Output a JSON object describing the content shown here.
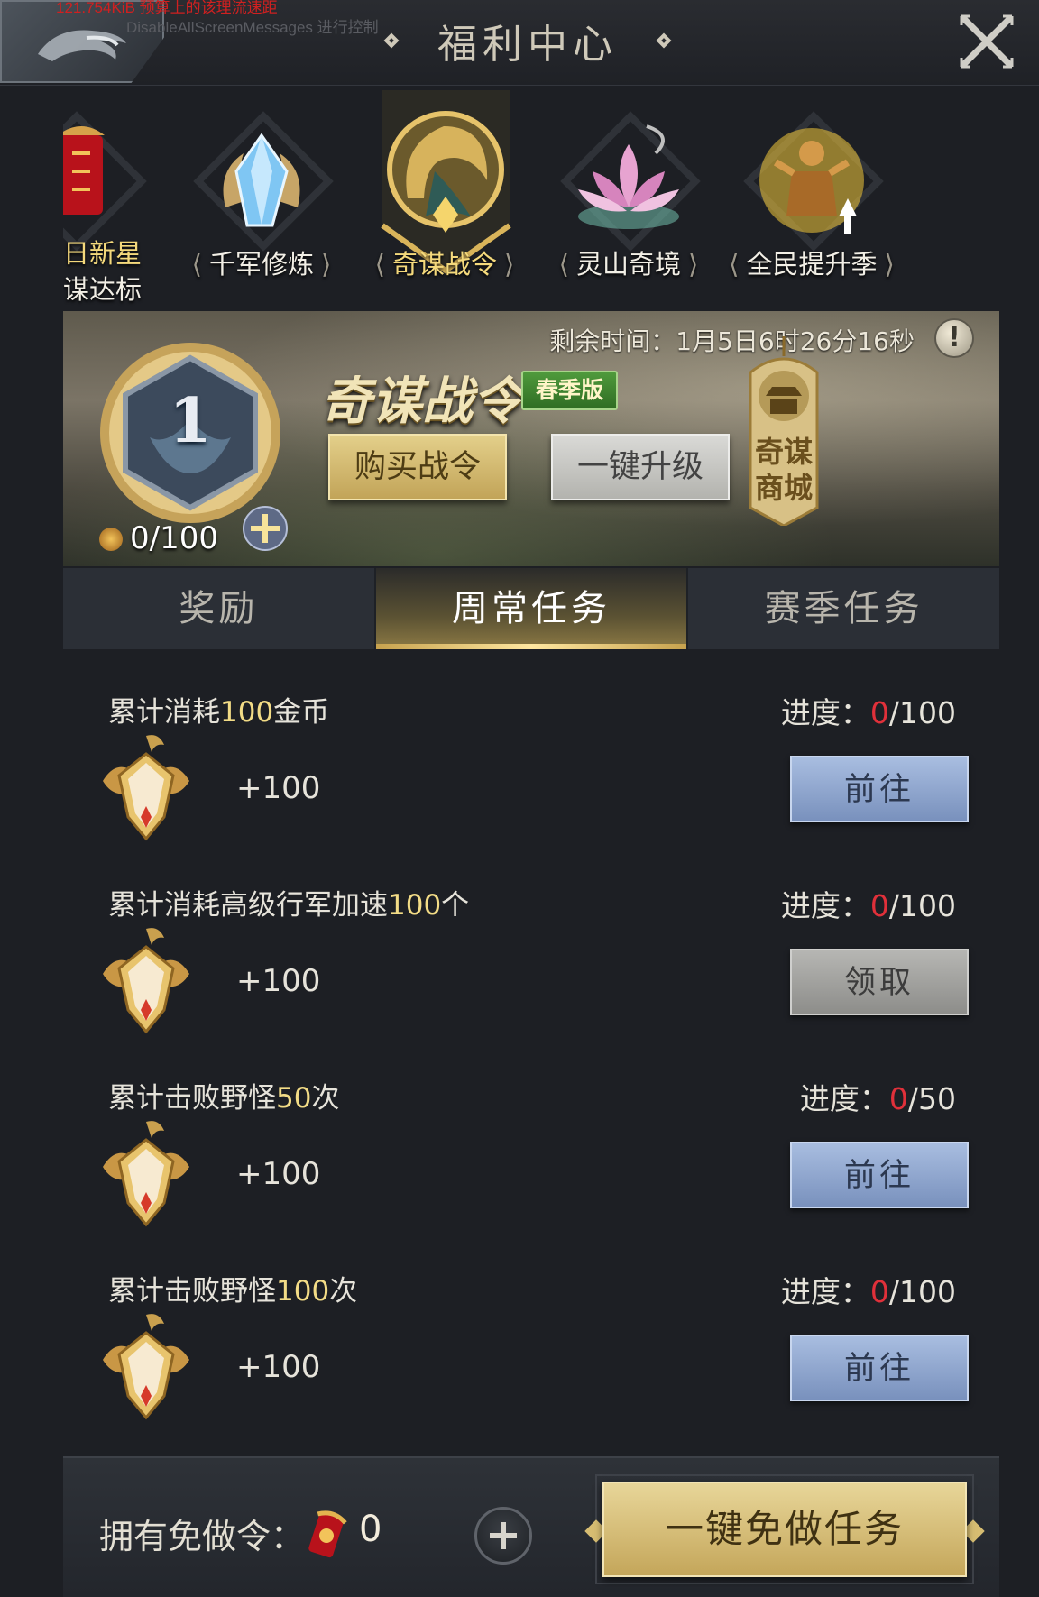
{
  "debug": {
    "line1": "121.754KiB 预算上的该理流速距",
    "line2": "DisableAllScreenMessages 进行控制"
  },
  "header": {
    "title": "福利中心"
  },
  "events": {
    "cut_label1": "日新星",
    "cut_label2": "谋达标",
    "items": [
      {
        "label": "千军修炼",
        "icon": "crystal-icon"
      },
      {
        "label": "奇谋战令",
        "icon": "golden-dragon-icon"
      },
      {
        "label": "灵山奇境",
        "icon": "lotus-icon"
      },
      {
        "label": "全民提升季",
        "icon": "warrior-icon"
      }
    ]
  },
  "pass": {
    "remaining": "剩余时间：1月5日6时26分16秒",
    "level": "1",
    "points": "0/100",
    "title": "奇谋战令",
    "season_tag": "春季版",
    "buy_label": "购买战令",
    "upgrade_label": "一键升级",
    "shop_label_1": "奇谋",
    "shop_label_2": "商城"
  },
  "tabs": [
    {
      "label": "奖励"
    },
    {
      "label": "周常任务"
    },
    {
      "label": "赛季任务"
    }
  ],
  "tasks": [
    {
      "prefix": "累计消耗",
      "num": "100",
      "suffix": "金币",
      "progress_label": "进度：",
      "current": "0",
      "total": "/100",
      "reward": "+100",
      "button": "前往",
      "button_type": "go"
    },
    {
      "prefix": "累计消耗高级行军加速",
      "num": "100",
      "suffix": "个",
      "progress_label": "进度：",
      "current": "0",
      "total": "/100",
      "reward": "+100",
      "button": "领取",
      "button_type": "claim"
    },
    {
      "prefix": "累计击败野怪",
      "num": "50",
      "suffix": "次",
      "progress_label": "进度：",
      "current": "0",
      "total": "/50",
      "reward": "+100",
      "button": "前往",
      "button_type": "go"
    },
    {
      "prefix": "累计击败野怪",
      "num": "100",
      "suffix": "次",
      "progress_label": "进度：",
      "current": "0",
      "total": "/100",
      "reward": "+100",
      "button": "前往",
      "button_type": "go"
    }
  ],
  "bottom": {
    "owned_label": "拥有免做令：",
    "owned_count": "0",
    "free_all_label": "一键免做任务"
  },
  "colors": {
    "accent_gold": "#e3cf8a",
    "progress_red": "#e0303a",
    "highlight_yellow": "#f3dc86",
    "go_button_blue": "#8fa6cf"
  }
}
